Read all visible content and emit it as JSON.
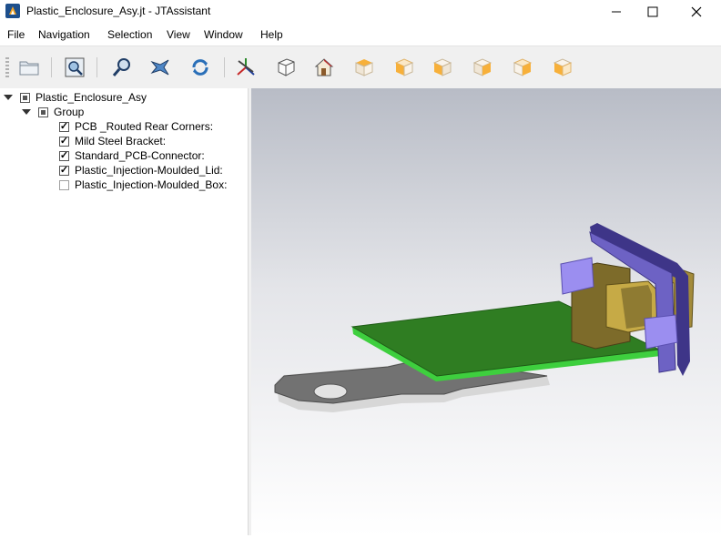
{
  "window": {
    "title": "Plastic_Enclosure_Asy.jt - JTAssistant",
    "minimize_glyph": "—",
    "maximize_glyph": "☐",
    "close_glyph": "✕"
  },
  "menu": [
    "File",
    "Navigation",
    "Selection",
    "View",
    "Window",
    "Help"
  ],
  "toolbar": {
    "buttons": [
      "open-folder-icon",
      "fit-view-icon",
      "zoom-icon",
      "fly-icon",
      "rotate-icon",
      "axes-icon",
      "wireframe-cube-icon",
      "home-view-icon",
      "view-isometric-icon",
      "view-top-icon",
      "view-left-icon",
      "view-front-icon",
      "view-right-icon",
      "view-back-icon"
    ]
  },
  "tree": {
    "root": {
      "label": "Plastic_Enclosure_Asy",
      "state": "partial"
    },
    "group": {
      "label": "Group",
      "state": "partial"
    },
    "items": [
      {
        "label": "PCB _Routed Rear Corners:",
        "checked": true
      },
      {
        "label": "Mild Steel Bracket:",
        "checked": true
      },
      {
        "label": "Standard_PCB-Connector:",
        "checked": true
      },
      {
        "label": "Plastic_Injection-Moulded_Lid:",
        "checked": true
      },
      {
        "label": "Plastic_Injection-Moulded_Box:",
        "checked": false
      }
    ],
    "check_glyph": "✓"
  },
  "colors": {
    "pcb_green": "#2f7d22",
    "pcb_edge": "#3ecf3e",
    "bracket_gray": "#6f6f6f",
    "connector_olive": "#7d6b2a",
    "lid_purple": "#6d62c4",
    "tab_lavender": "#9b8ef0"
  }
}
